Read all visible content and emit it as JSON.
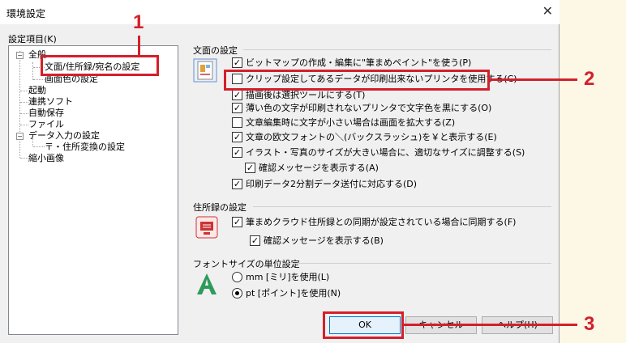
{
  "window": {
    "title": "環境設定",
    "close_glyph": "✕"
  },
  "tree": {
    "label": "設定項目(K)",
    "items": [
      {
        "text": "全般"
      },
      {
        "text": "文面/住所録/宛名の設定"
      },
      {
        "text": "画面色の設定"
      },
      {
        "text": "起動"
      },
      {
        "text": "連携ソフト"
      },
      {
        "text": "自動保存"
      },
      {
        "text": "ファイル"
      },
      {
        "text": "データ入力の設定"
      },
      {
        "text": "〒・住所変換の設定"
      },
      {
        "text": "縮小画像"
      }
    ]
  },
  "sections": {
    "bunmen": {
      "title": "文面の設定",
      "options": [
        {
          "label": "ビットマップの作成・編集に\"筆まめペイント\"を使う(P)",
          "checked": true
        },
        {
          "label": "クリップ設定してあるデータが印刷出来ないプリンタを使用する(C)",
          "checked": false
        },
        {
          "label": "描画後は選択ツールにする(T)",
          "checked": true
        },
        {
          "label": "薄い色の文字が印刷されないプリンタで文字色を黒にする(O)",
          "checked": true
        },
        {
          "label": "文章編集時に文字が小さい場合は画面を拡大する(Z)",
          "checked": false
        },
        {
          "label": "文章の欧文フォントの＼(バックスラッシュ)を￥と表示する(E)",
          "checked": true
        },
        {
          "label": "イラスト・写真のサイズが大きい場合に、適切なサイズに調整する(S)",
          "checked": true
        },
        {
          "label": "確認メッセージを表示する(A)",
          "checked": true
        },
        {
          "label": "印刷データ2分割データ送付に対応する(D)",
          "checked": true
        }
      ]
    },
    "address": {
      "title": "住所録の設定",
      "options": [
        {
          "label": "筆まめクラウド住所録との同期が設定されている場合に同期する(F)",
          "checked": true
        },
        {
          "label": "確認メッセージを表示する(B)",
          "checked": true
        }
      ]
    },
    "font_unit": {
      "title": "フォントサイズの単位設定",
      "options": [
        {
          "label": "mm [ミリ]を使用(L)",
          "selected": false
        },
        {
          "label": "pt [ポイント]を使用(N)",
          "selected": true
        }
      ]
    }
  },
  "buttons": {
    "ok": "OK",
    "cancel": "キャンセル",
    "help": "ヘルプ(H)"
  },
  "callouts": {
    "c1": "1",
    "c2": "2",
    "c3": "3"
  },
  "check_glyph": "✓",
  "colors": {
    "highlight": "#d3202a",
    "dialog_bg": "#f0f0f0",
    "page_bg": "#fdf7e6"
  }
}
